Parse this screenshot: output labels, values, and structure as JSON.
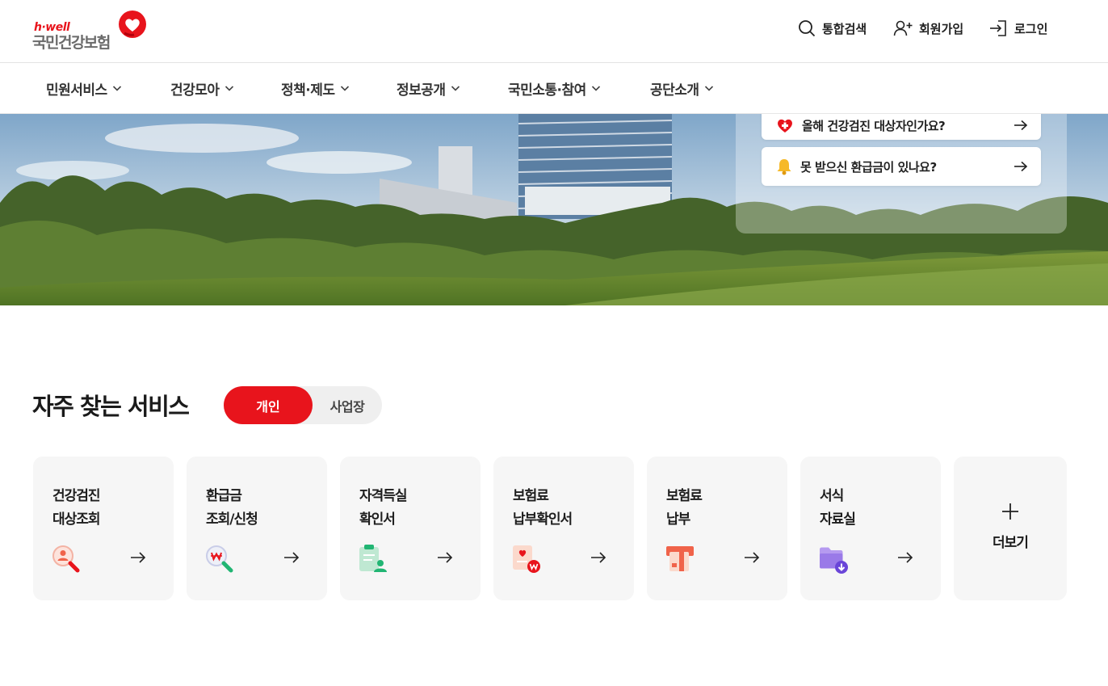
{
  "header": {
    "logo_tagline": "h·well",
    "logo_name": "국민건강보험",
    "utils": [
      {
        "label": "통합검색",
        "icon": "search-icon"
      },
      {
        "label": "회원가입",
        "icon": "user-plus-icon"
      },
      {
        "label": "로그인",
        "icon": "login-icon"
      }
    ]
  },
  "nav": {
    "items": [
      {
        "label": "민원서비스"
      },
      {
        "label": "건강모아"
      },
      {
        "label": "정책·제도"
      },
      {
        "label": "정보공개"
      },
      {
        "label": "국민소통·참여"
      },
      {
        "label": "공단소개"
      }
    ]
  },
  "hero": {
    "quick_links": [
      {
        "label": "올해 건강검진 대상자인가요?",
        "icon": "heart-plus-icon"
      },
      {
        "label": "못 받으신 환급금이 있나요?",
        "icon": "bell-icon"
      }
    ]
  },
  "services": {
    "title": "자주 찾는 서비스",
    "tabs": {
      "active": "개인",
      "inactive": "사업장"
    },
    "items": [
      {
        "line1": "건강검진",
        "line2": "대상조회",
        "icon": "person-search-icon"
      },
      {
        "line1": "환급금",
        "line2": "조회/신청",
        "icon": "won-search-icon"
      },
      {
        "line1": "자격득실",
        "line2": "확인서",
        "icon": "clipboard-user-icon"
      },
      {
        "line1": "보험료",
        "line2": "납부확인서",
        "icon": "document-won-icon"
      },
      {
        "line1": "보험료",
        "line2": "납부",
        "icon": "card-payment-icon"
      },
      {
        "line1": "서식",
        "line2": "자료실",
        "icon": "folder-download-icon"
      }
    ],
    "more_label": "더보기"
  },
  "colors": {
    "brand_red": "#e8141c",
    "card_bg": "#f6f6f6"
  }
}
